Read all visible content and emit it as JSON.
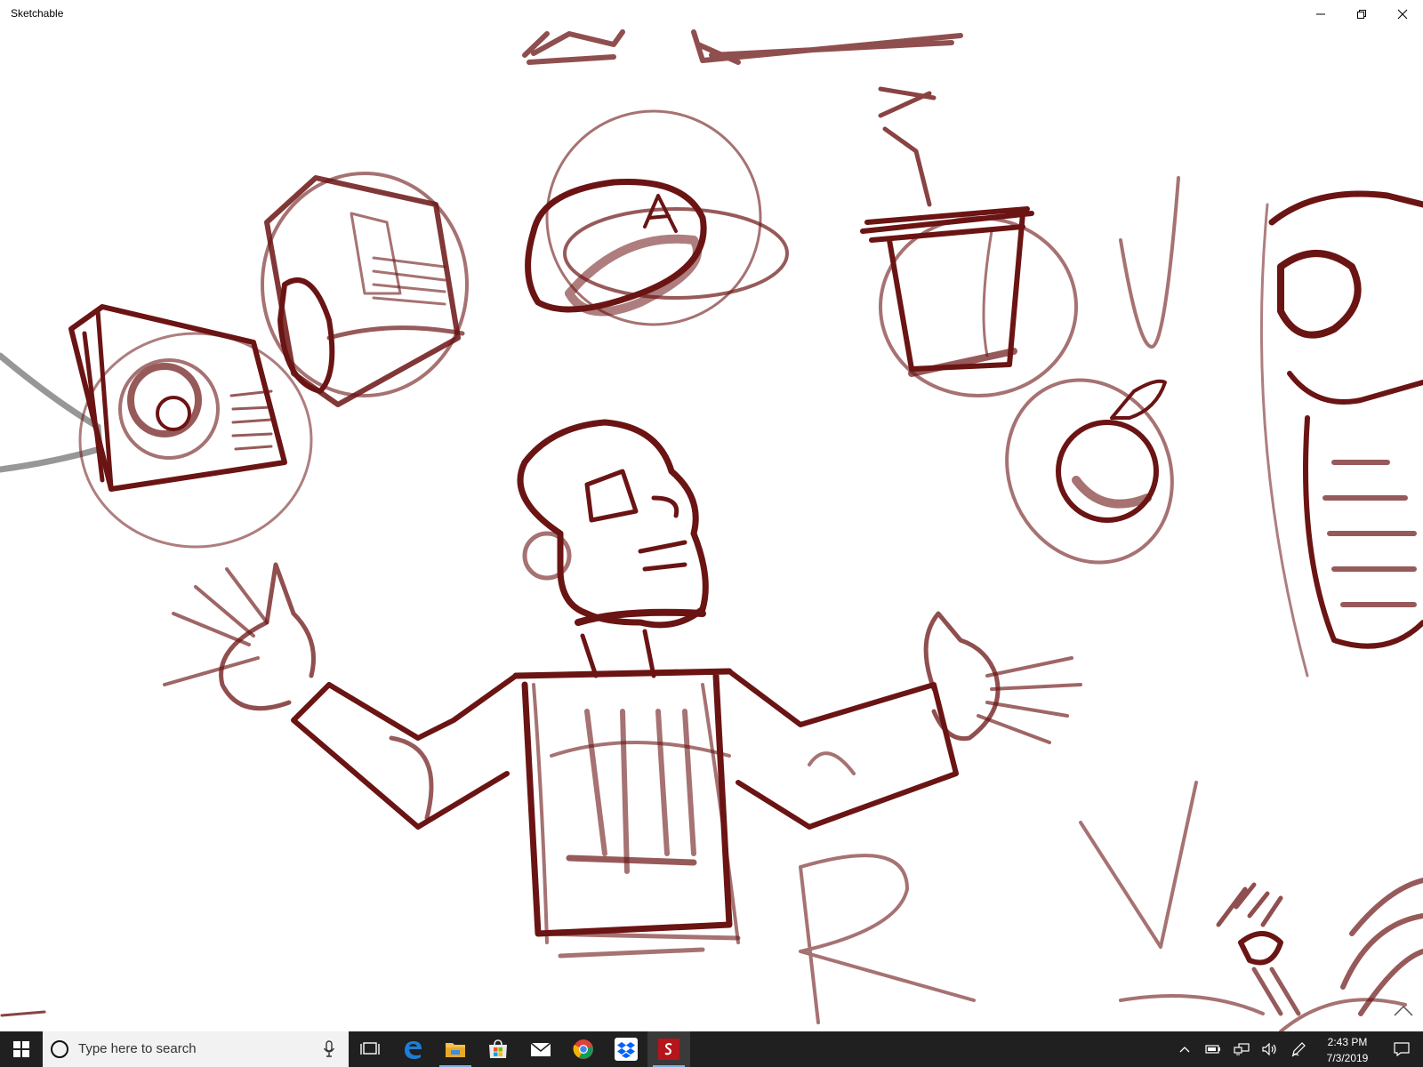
{
  "window": {
    "title": "Sketchable",
    "controls": [
      "minimize-icon",
      "restore-icon",
      "close-icon"
    ]
  },
  "canvas": {
    "stroke_color": "#6b1414",
    "guide_stroke_color": "#8c8c8c"
  },
  "taskbar": {
    "search_placeholder": "Type here to search",
    "pinned_apps": [
      "task-view-icon",
      "edge-icon",
      "file-explorer-icon",
      "store-icon",
      "mail-icon",
      "chrome-icon",
      "dropbox-icon",
      "sketchable-icon"
    ],
    "active_app": "sketchable-icon",
    "tray_icons": [
      "show-hidden-icons-icon",
      "battery-icon",
      "network-icon",
      "volume-icon",
      "pen-icon"
    ],
    "time": "2:43 PM",
    "date": "7/3/2019",
    "colors": {
      "background": "#202020",
      "search_box": "#f2f2f2",
      "active_indicator": "#7ab0e0"
    }
  }
}
